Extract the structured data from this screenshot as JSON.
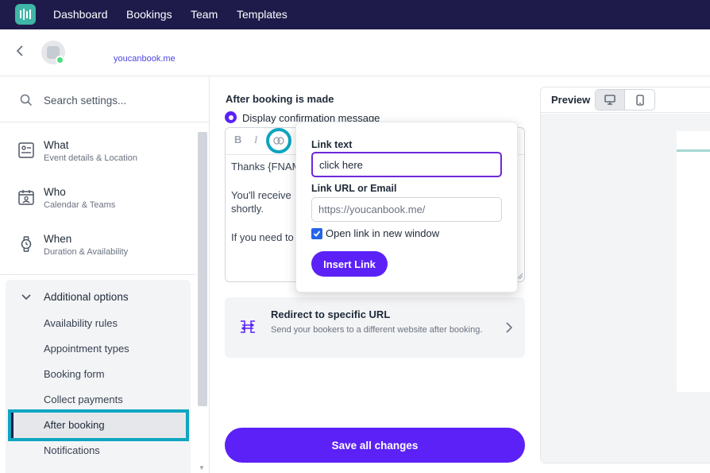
{
  "nav": {
    "items": [
      "Dashboard",
      "Bookings",
      "Team",
      "Templates"
    ]
  },
  "header": {
    "site_link": "youcanbook.me"
  },
  "sidebar": {
    "search_placeholder": "Search settings...",
    "main_items": [
      {
        "title": "What",
        "subtitle": "Event details & Location",
        "icon": "id-card-icon"
      },
      {
        "title": "Who",
        "subtitle": "Calendar & Teams",
        "icon": "calendar-person-icon"
      },
      {
        "title": "When",
        "subtitle": "Duration & Availability",
        "icon": "watch-icon"
      }
    ],
    "additional_title": "Additional options",
    "sub_items": [
      "Availability rules",
      "Appointment types",
      "Booking form",
      "Collect payments",
      "After booking",
      "Notifications"
    ],
    "active_item": "After booking"
  },
  "main": {
    "section_title": "After booking is made",
    "radio_label": "Display confirmation message",
    "editor_lines": [
      "Thanks {FNAM",
      "You'll receive",
      "shortly.",
      "If you need to"
    ],
    "toolbar": {
      "bold": "B",
      "italic": "I"
    },
    "redirect": {
      "title": "Redirect to specific URL",
      "description": "Send your bookers to a different website after booking."
    },
    "save_label": "Save all changes"
  },
  "link_popover": {
    "link_text_label": "Link text",
    "link_text_value": "click here",
    "link_url_label": "Link URL or Email",
    "link_url_placeholder": "https://youcanbook.me/",
    "open_new_window_label": "Open link in new window",
    "open_new_window_checked": true,
    "insert_label": "Insert Link"
  },
  "preview": {
    "label": "Preview",
    "devices": [
      "desktop-icon",
      "mobile-icon"
    ],
    "active_device": "desktop-icon"
  },
  "colors": {
    "nav_bg": "#1e1b4b",
    "accent": "#5b21f6",
    "highlight": "#0ea5c0",
    "logo": "#3fb5a8"
  }
}
